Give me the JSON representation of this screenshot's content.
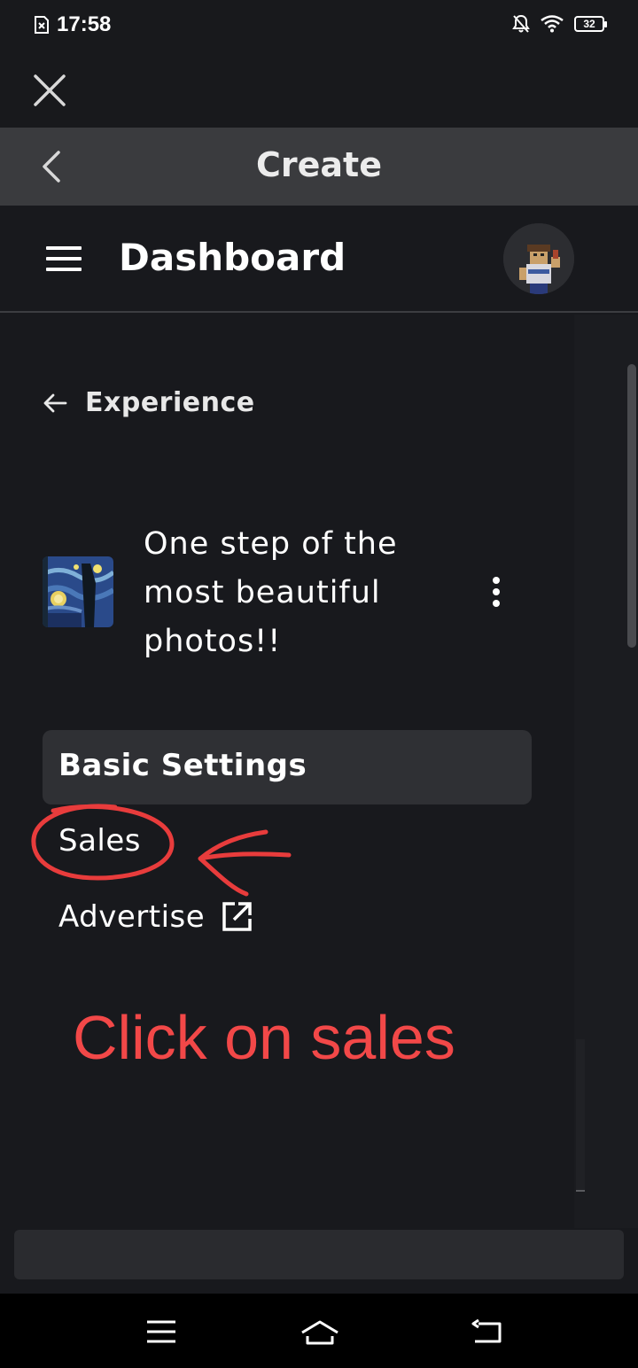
{
  "status_bar": {
    "time": "17:58",
    "battery": "32"
  },
  "header": {
    "title": "Create"
  },
  "dashboard": {
    "title": "Dashboard"
  },
  "experience": {
    "back_label": "Experience",
    "title": "One step of the most beautiful photos!!"
  },
  "menu": {
    "items": [
      {
        "label": "Basic Settings",
        "active": true
      },
      {
        "label": "Sales",
        "active": false
      },
      {
        "label": "Advertise",
        "active": false,
        "external": true
      }
    ]
  },
  "annotation": {
    "text": "Click on sales",
    "color": "#f24848"
  },
  "colors": {
    "background": "#18191d",
    "header_bar": "#3a3b3e",
    "active_item": "#2f3034"
  }
}
